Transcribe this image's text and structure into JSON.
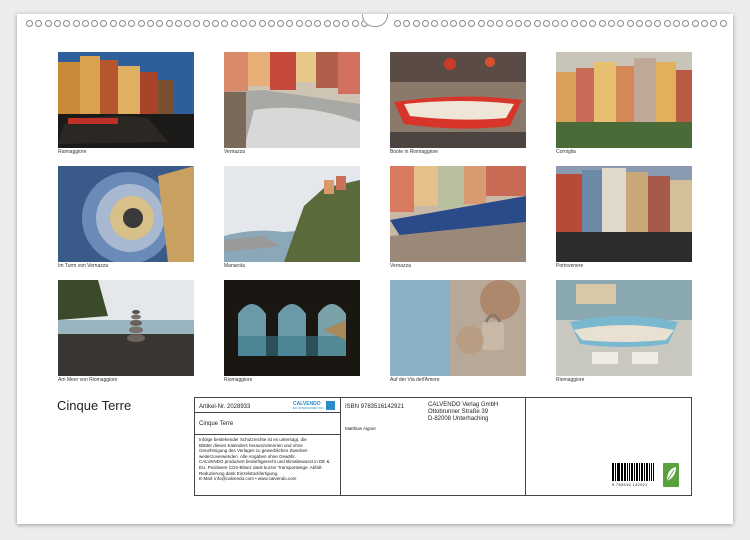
{
  "calendar_title": "Cinque Terre",
  "photos": [
    {
      "caption": "Riomaggiore"
    },
    {
      "caption": "Vernazza"
    },
    {
      "caption": "Boote in Riomaggiore"
    },
    {
      "caption": "Corniglia"
    },
    {
      "caption": "Im Turm von Vernazza"
    },
    {
      "caption": "Manarola"
    },
    {
      "caption": "Vernazza"
    },
    {
      "caption": "Portovenere"
    },
    {
      "caption": "Am Meer von Riomaggiore"
    },
    {
      "caption": "Riomaggiore"
    },
    {
      "caption": "Auf der Via dell'Amore"
    },
    {
      "caption": "Riomaggiore"
    }
  ],
  "info": {
    "article_number": "Artikel-Nr. 2028933",
    "product_title": "Cinque Terre",
    "logo_text": "CALVENDO",
    "logo_sub": "EIN UNTERNEHMEN VON",
    "legal_lines": [
      "Infolge bestehender Schutzrechte ist es untersagt, die",
      "Blätter dieses Kalenders herauszutrennen und ohne",
      "Genehmigung des Verlages zu gewerblichen Zwecken",
      "weiterzuverwenden. Alle Angaben ohne Gewähr.",
      "CALVENDO produziert bedarfsgerecht und klimabewusst in DE &",
      "EU. Positivere CO2-Bilanz dank kurzer Transportwege. Abfall-",
      "Reduzierung dank Einzelstückfertigung.",
      "E-Mail: info@calvendo.com • www.calvendo.com"
    ],
    "isbn": "ISBN 9783516142921",
    "author": "Matthias Aigner",
    "publisher_lines": [
      "CALVENDO Verlag GmbH",
      "Ottobrunner Straße 39",
      "D-82008 Unterhaching"
    ],
    "barcode_number": "9 783516 142921"
  },
  "colors": {
    "accent": "#2a8bc6",
    "eco_badge": "#5aa03c"
  }
}
